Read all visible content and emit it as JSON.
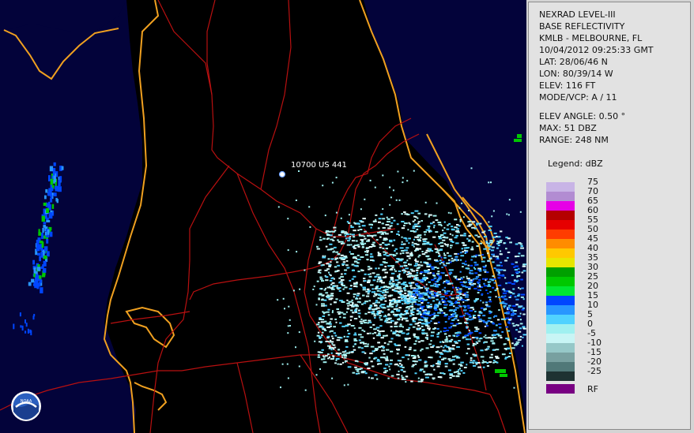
{
  "map": {
    "place_label": "10700 US 441",
    "colors": {
      "background": "#03033a",
      "land": "#000000",
      "coast": "#f0a020",
      "roads": "#c01010",
      "echo_light": "#a0f0f0",
      "echo_blue": "#1060e0"
    },
    "logo": "noaa-logo"
  },
  "info": {
    "product": "NEXRAD LEVEL-III",
    "type": "BASE REFLECTIVITY",
    "station": "KMLB - MELBOURNE, FL",
    "datetime": "10/04/2012 09:25:33 GMT",
    "lat": "LAT: 28/06/46 N",
    "lon": "LON: 80/39/14 W",
    "elev": "ELEV: 116 FT",
    "mode": "MODE/VCP: A / 11",
    "elev_angle": "ELEV ANGLE: 0.50 °",
    "max": "MAX: 51 DBZ",
    "range": "RANGE: 248 NM"
  },
  "legend": {
    "title": "Legend: dBZ",
    "bins": [
      {
        "label": "75",
        "color": "#c8b4e6"
      },
      {
        "label": "70",
        "color": "#b28cd2"
      },
      {
        "label": "65",
        "color": "#e600e6"
      },
      {
        "label": "60",
        "color": "#b40000"
      },
      {
        "label": "55",
        "color": "#e60000"
      },
      {
        "label": "50",
        "color": "#ff3c00"
      },
      {
        "label": "45",
        "color": "#ff8c00"
      },
      {
        "label": "40",
        "color": "#ffc800"
      },
      {
        "label": "35",
        "color": "#e6e600"
      },
      {
        "label": "30",
        "color": "#00a000"
      },
      {
        "label": "25",
        "color": "#00c800"
      },
      {
        "label": "20",
        "color": "#00e632"
      },
      {
        "label": "15",
        "color": "#0046ff"
      },
      {
        "label": "10",
        "color": "#2896ff"
      },
      {
        "label": "5",
        "color": "#50d2ff"
      },
      {
        "label": "0",
        "color": "#a0f0f0"
      },
      {
        "label": "-5",
        "color": "#c8f5f5"
      },
      {
        "label": "-10",
        "color": "#96c8c8"
      },
      {
        "label": "-15",
        "color": "#78a0a0"
      },
      {
        "label": "-20",
        "color": "#507878"
      },
      {
        "label": "-25",
        "color": "#1e3232"
      }
    ],
    "rf": {
      "label": "RF",
      "color": "#780082"
    }
  }
}
